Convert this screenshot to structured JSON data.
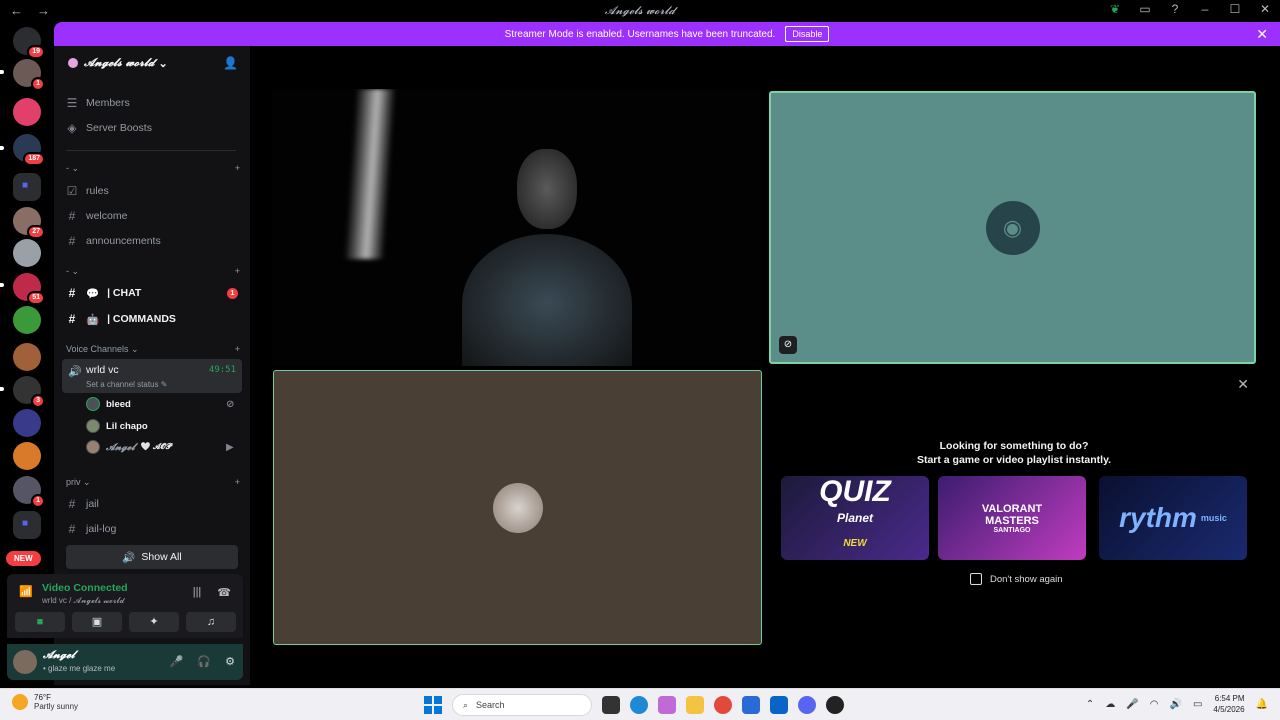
{
  "window": {
    "title": "𝓐𝓷𝓰𝓮𝓵𝓼 𝔀𝓸𝓻𝓵𝓭",
    "nav_back": "←",
    "nav_forward": "→"
  },
  "banner": {
    "text": "Streamer Mode is enabled. Usernames have been truncated.",
    "button": "Disable",
    "close": "✕"
  },
  "rail": {
    "new_label": "NEW",
    "badges": [
      "19",
      "1",
      "187",
      "27",
      "51",
      "3",
      "1"
    ]
  },
  "guild": {
    "name": "𝓐𝓷𝓰𝓮𝓵𝓼 𝔀𝓸𝓻𝓵𝓭"
  },
  "sidebar": {
    "members": "Members",
    "boosts": "Server Boosts",
    "cat1": "- ⌄",
    "rules": "rules",
    "welcome": "welcome",
    "announcements": "announcements",
    "cat2": "- ⌄",
    "chat": "| CHAT",
    "chat_badge": "1",
    "commands": "| COMMANDS",
    "voice_cat": "Voice Channels ⌄",
    "vc_name": "wrld vc",
    "vc_timer": "49:51",
    "vc_status": "Set a channel status ✎",
    "m1": "bleed",
    "m2": "Lil chapo",
    "m3": "𝓐𝓷𝓰𝓮𝓵",
    "m3_tag": "🤍 𝓐𝓞𝓟",
    "priv": "priv ⌄",
    "jail": "jail",
    "jail_log": "jail-log",
    "show_all": "Show All",
    "plus": "+"
  },
  "voice_panel": {
    "status": "Video Connected",
    "sub": "wrld vc / 𝓐𝓷𝓰𝓮𝓵𝓼 𝔀𝓸𝓻𝓵𝓭"
  },
  "user_panel": {
    "name": "𝓐𝓷𝓰𝓮𝓵",
    "status": "• glaze me glaze me"
  },
  "activity": {
    "line1": "Looking for something to do?",
    "line2": "Start a game or video playlist instantly.",
    "card1_title": "QUIZ",
    "card1_sub": "Planet",
    "card1_tag": "NEW",
    "card2_title": "VALORANT",
    "card2_sub": "MASTERS",
    "card2_place": "SANTIAGO",
    "card3_title": "rythm",
    "card3_sub": "music",
    "dont_show": "Don't show again",
    "close": "✕"
  },
  "taskbar": {
    "temp": "76°F",
    "weather": "Partly sunny",
    "search": "Search",
    "time": "6:54 PM",
    "date": "4/5/2026"
  },
  "colors": {
    "banner": "#9b30ff",
    "connected_green": "#23a55a",
    "teal_tile": "#5b8d89",
    "brown_tile": "#4a3f35"
  }
}
